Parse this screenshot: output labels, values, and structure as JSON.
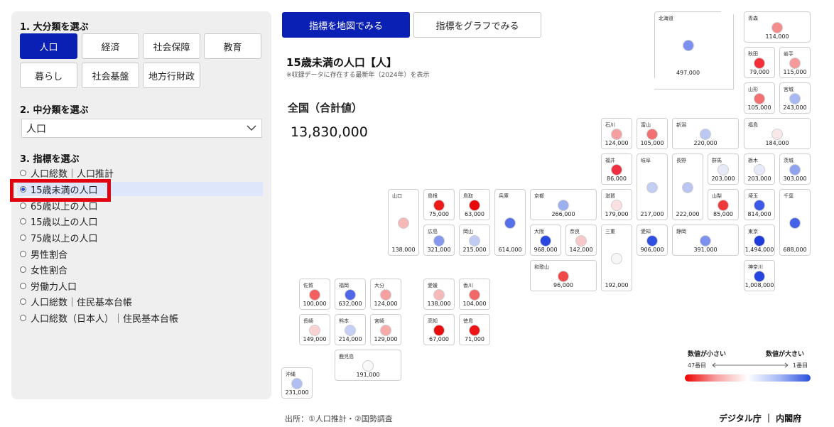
{
  "sidebar": {
    "section1_title": "1. 大分類を選ぶ",
    "categories": [
      "人口",
      "経済",
      "社会保障",
      "教育",
      "暮らし",
      "社会基盤",
      "地方行財政"
    ],
    "active_category": "人口",
    "section2_title": "2. 中分類を選ぶ",
    "subcategory_value": "人口",
    "section3_title": "3. 指標を選ぶ",
    "indicators": [
      "人口総数｜人口推計",
      "15歳未満の人口",
      "65歳以上の人口",
      "15歳以上の人口",
      "75歳以上の人口",
      "男性割合",
      "女性割合",
      "労働力人口",
      "人口総数｜住民基本台帳",
      "人口総数（日本人）｜住民基本台帳"
    ],
    "selected_indicator": "15歳未満の人口"
  },
  "tabs": {
    "map": "指標を地図でみる",
    "graph": "指標をグラフでみる"
  },
  "indicator": {
    "title": "15歳未満の人口【人】",
    "note": "※収録データに存在する最新年（2024年）を表示",
    "national_label": "全国（合計値）",
    "national_value": "13,830,000"
  },
  "prefectures": [
    {
      "name": "北海道",
      "value": "497,000",
      "color": "#7b90f0"
    },
    {
      "name": "青森",
      "value": "114,000",
      "color": "#f58c8c"
    },
    {
      "name": "秋田",
      "value": "79,000",
      "color": "#f2303a"
    },
    {
      "name": "岩手",
      "value": "115,000",
      "color": "#f59a9a"
    },
    {
      "name": "山形",
      "value": "105,000",
      "color": "#f27070"
    },
    {
      "name": "宮城",
      "value": "243,000",
      "color": "#a8b8f2"
    },
    {
      "name": "石川",
      "value": "124,000",
      "color": "#f5a0a0"
    },
    {
      "name": "富山",
      "value": "105,000",
      "color": "#f27070"
    },
    {
      "name": "新潟",
      "value": "220,000",
      "color": "#bcc8f4"
    },
    {
      "name": "福島",
      "value": "184,000",
      "color": "#f9e8e8"
    },
    {
      "name": "福井",
      "value": "86,000",
      "color": "#f03040"
    },
    {
      "name": "岐阜",
      "value": "217,000",
      "color": "#c4cef4"
    },
    {
      "name": "長野",
      "value": "222,000",
      "color": "#bcc6f2"
    },
    {
      "name": "群馬",
      "value": "203,000",
      "color": "#e6eaf8"
    },
    {
      "name": "栃木",
      "value": "203,000",
      "color": "#e6eaf8"
    },
    {
      "name": "茨城",
      "value": "303,000",
      "color": "#8ea2ee"
    },
    {
      "name": "山口",
      "value": "138,000",
      "color": "#f7b8b8"
    },
    {
      "name": "島根",
      "value": "75,000",
      "color": "#ee1a1a"
    },
    {
      "name": "鳥取",
      "value": "63,000",
      "color": "#e80808"
    },
    {
      "name": "兵庫",
      "value": "614,000",
      "color": "#5670ea"
    },
    {
      "name": "京都",
      "value": "266,000",
      "color": "#9cafef"
    },
    {
      "name": "滋賀",
      "value": "179,000",
      "color": "#fae0e0"
    },
    {
      "name": "山梨",
      "value": "85,000",
      "color": "#f03a3a"
    },
    {
      "name": "埼玉",
      "value": "814,000",
      "color": "#3c5ae6"
    },
    {
      "name": "千葉",
      "value": "688,000",
      "color": "#4462e8"
    },
    {
      "name": "広島",
      "value": "321,000",
      "color": "#8598ee"
    },
    {
      "name": "岡山",
      "value": "215,000",
      "color": "#c0ccf4"
    },
    {
      "name": "大阪",
      "value": "968,000",
      "color": "#2a48e0"
    },
    {
      "name": "奈良",
      "value": "142,000",
      "color": "#f8c8c8"
    },
    {
      "name": "三重",
      "value": "192,000",
      "color": "#f7f7f7"
    },
    {
      "name": "愛知",
      "value": "906,000",
      "color": "#3050e2"
    },
    {
      "name": "静岡",
      "value": "391,000",
      "color": "#7d92ee"
    },
    {
      "name": "東京",
      "value": "1,494,000",
      "color": "#1e3cdc"
    },
    {
      "name": "和歌山",
      "value": "96,000",
      "color": "#f04848"
    },
    {
      "name": "神奈川",
      "value": "1,008,000",
      "color": "#2644de"
    },
    {
      "name": "佐賀",
      "value": "100,000",
      "color": "#f26060"
    },
    {
      "name": "福岡",
      "value": "632,000",
      "color": "#5068e8"
    },
    {
      "name": "大分",
      "value": "124,000",
      "color": "#f5a0a0"
    },
    {
      "name": "愛媛",
      "value": "138,000",
      "color": "#f7b8b8"
    },
    {
      "name": "香川",
      "value": "104,000",
      "color": "#f26868"
    },
    {
      "name": "長崎",
      "value": "149,000",
      "color": "#f9d2d2"
    },
    {
      "name": "熊本",
      "value": "214,000",
      "color": "#c6d0f4"
    },
    {
      "name": "宮崎",
      "value": "129,000",
      "color": "#f6aaaa"
    },
    {
      "name": "高知",
      "value": "67,000",
      "color": "#e80c0c"
    },
    {
      "name": "徳島",
      "value": "71,000",
      "color": "#ec1414"
    },
    {
      "name": "鹿児島",
      "value": "191,000",
      "color": "#f9f9f9"
    },
    {
      "name": "沖縄",
      "value": "231,000",
      "color": "#b0bef2"
    }
  ],
  "legend": {
    "small_label": "数値が小さい",
    "large_label": "数値が大きい",
    "rank_low": "47番目",
    "rank_high": "1番目"
  },
  "footer": {
    "source": "出所：①人口推計・②国勢調査",
    "org": "デジタル庁 ｜ 内閣府"
  }
}
